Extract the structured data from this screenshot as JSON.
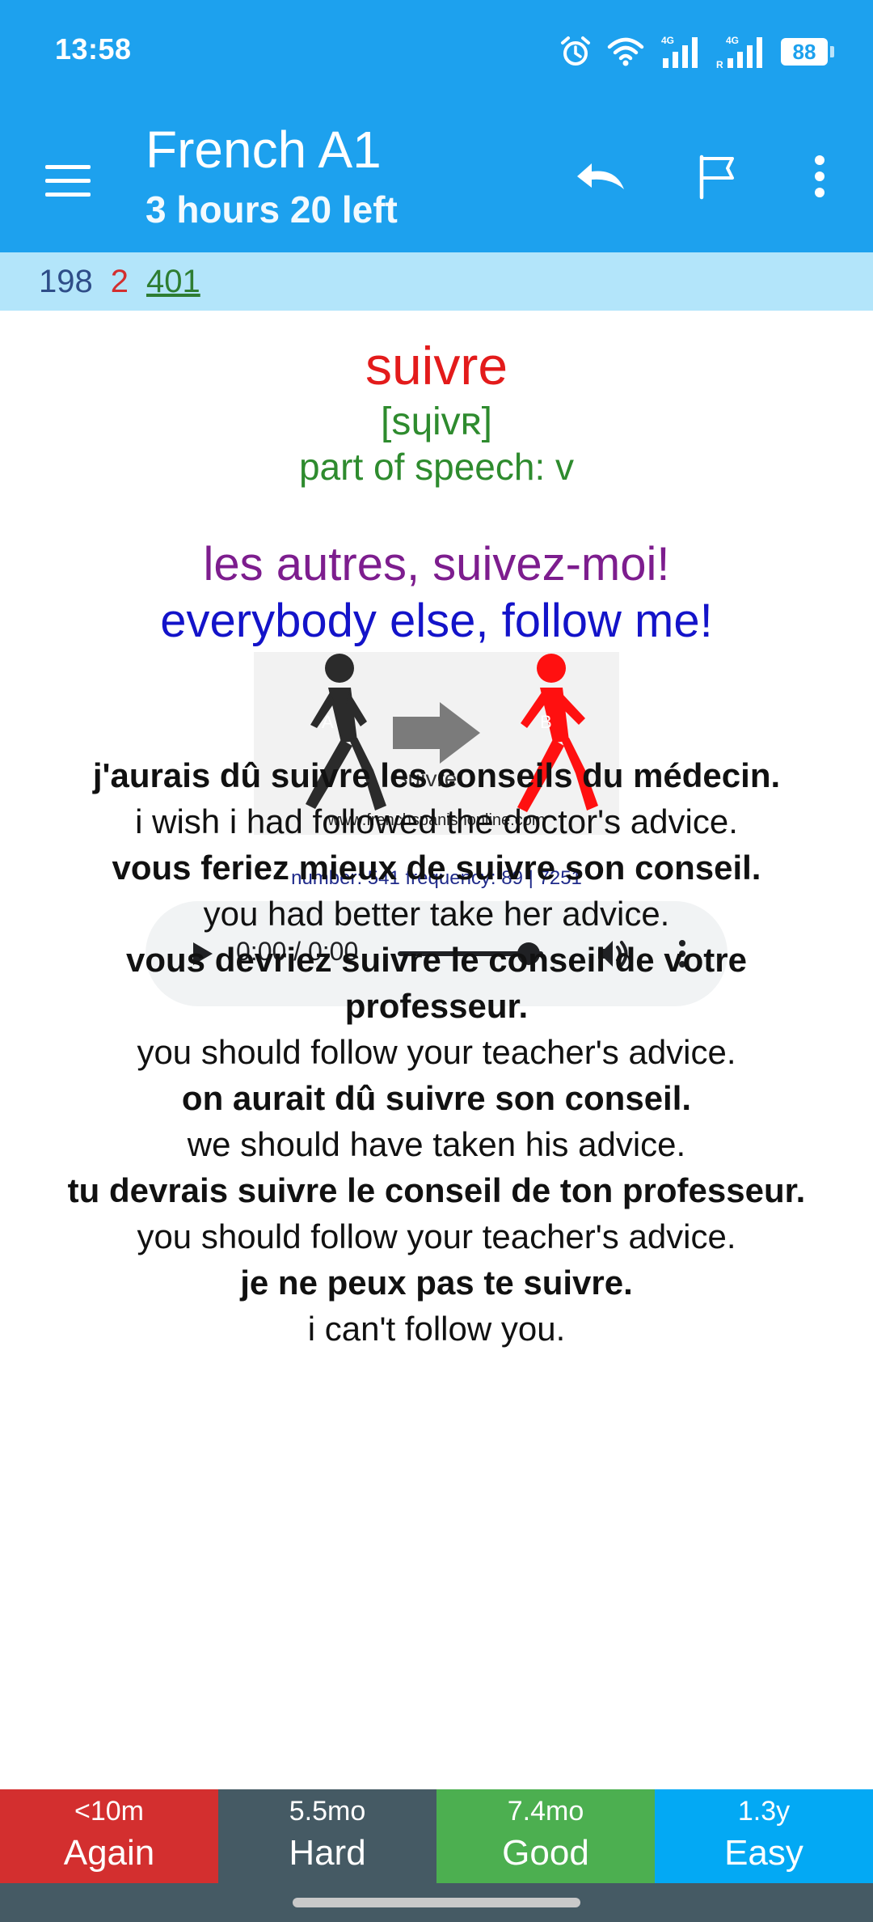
{
  "status_bar": {
    "time": "13:58",
    "battery": "88",
    "network_1": "4G",
    "network_2": "4G",
    "roaming": "R"
  },
  "toolbar": {
    "title": "French A1",
    "subtitle": "3 hours 20 left"
  },
  "counts": {
    "new": "198",
    "learning": "2",
    "review": "401"
  },
  "card": {
    "word": "suivre",
    "ipa": "[sɥivʀ]",
    "part_of_speech": "part of speech: v",
    "example_fr": "les autres, suivez-moi!",
    "example_en": "everybody else, follow me!",
    "image": {
      "label_a": "A",
      "label_b": "B",
      "arrow_text": "Suivre",
      "website": "www.frenchspanishonline.com"
    },
    "frequency_line": "number: 541 frequency: 89 | 7251"
  },
  "audio_player": {
    "time": "0:00 / 0:00",
    "progress": 0.9
  },
  "sentences": [
    {
      "fr": "j'aurais dû suivre les conseils du médecin.",
      "en": "i wish i had followed the doctor's advice."
    },
    {
      "fr": "vous feriez mieux de suivre son conseil.",
      "en": "you had better take her advice."
    },
    {
      "fr": "vous devriez suivre le conseil de votre professeur.",
      "en": "you should follow your teacher's advice."
    },
    {
      "fr": "on aurait dû suivre son conseil.",
      "en": "we should have taken his advice."
    },
    {
      "fr": "tu devrais suivre le conseil de ton professeur.",
      "en": "you should follow your teacher's advice."
    },
    {
      "fr": "je ne peux pas te suivre.",
      "en": "i can't follow you."
    }
  ],
  "answers": [
    {
      "interval": "<10m",
      "label": "Again",
      "color": "#d32f2f"
    },
    {
      "interval": "5.5mo",
      "label": "Hard",
      "color": "#455a64"
    },
    {
      "interval": "7.4mo",
      "label": "Good",
      "color": "#4caf50"
    },
    {
      "interval": "1.3y",
      "label": "Easy",
      "color": "#03a9f4"
    }
  ],
  "colors": {
    "appbar": "#1da1ee",
    "count_bar": "#b3e5fa",
    "word": "#e31b1b",
    "ipa": "#2e8b2e",
    "example_fr": "#7d1d8e",
    "example_en": "#1313c9"
  }
}
